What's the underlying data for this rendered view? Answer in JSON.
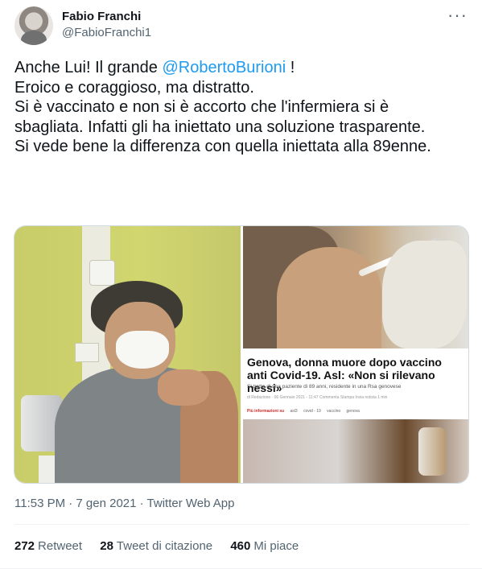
{
  "author": {
    "name": "Fabio Franchi",
    "handle": "@FabioFranchi1"
  },
  "tweet": {
    "segments": {
      "part1": "Anche Lui! Il grande ",
      "mention": "@RobertoBurioni",
      "part2": " !\nEroico e coraggioso, ma distratto.\nSi è vaccinato e non si è accorto che l'infermiera si è sbagliata. Infatti gli ha iniettato una soluzione trasparente.\nSi vede bene la differenza con quella iniettata alla 89enne."
    }
  },
  "media": {
    "headline": "Genova, donna muore dopo vaccino anti Covid-19. Asl: «Non si rilevano nessi»",
    "subline": "Si tratta di una paziente di 89 anni, residente in una Rsa genovese",
    "meta": "di Redazione · 06 Gennaio 2021 - 11:47   Commenta   Stampa   Invia notizia   1 min",
    "tags_label": "Più informazioni su",
    "tags": [
      "asl3",
      "covid - 19",
      "vaccino",
      "genova"
    ]
  },
  "timestamp": "11:53 PM · 7 gen 2021 · Twitter Web App",
  "stats": {
    "retweets_count": "272",
    "retweets_label": "Retweet",
    "quotes_count": "28",
    "quotes_label": "Tweet di citazione",
    "likes_count": "460",
    "likes_label": "Mi piace"
  },
  "icons": {
    "more": "more-icon"
  },
  "colors": {
    "accent": "#1d9bf0",
    "text": "#0f1419",
    "secondary": "#536471",
    "divider": "#eff3f4"
  }
}
